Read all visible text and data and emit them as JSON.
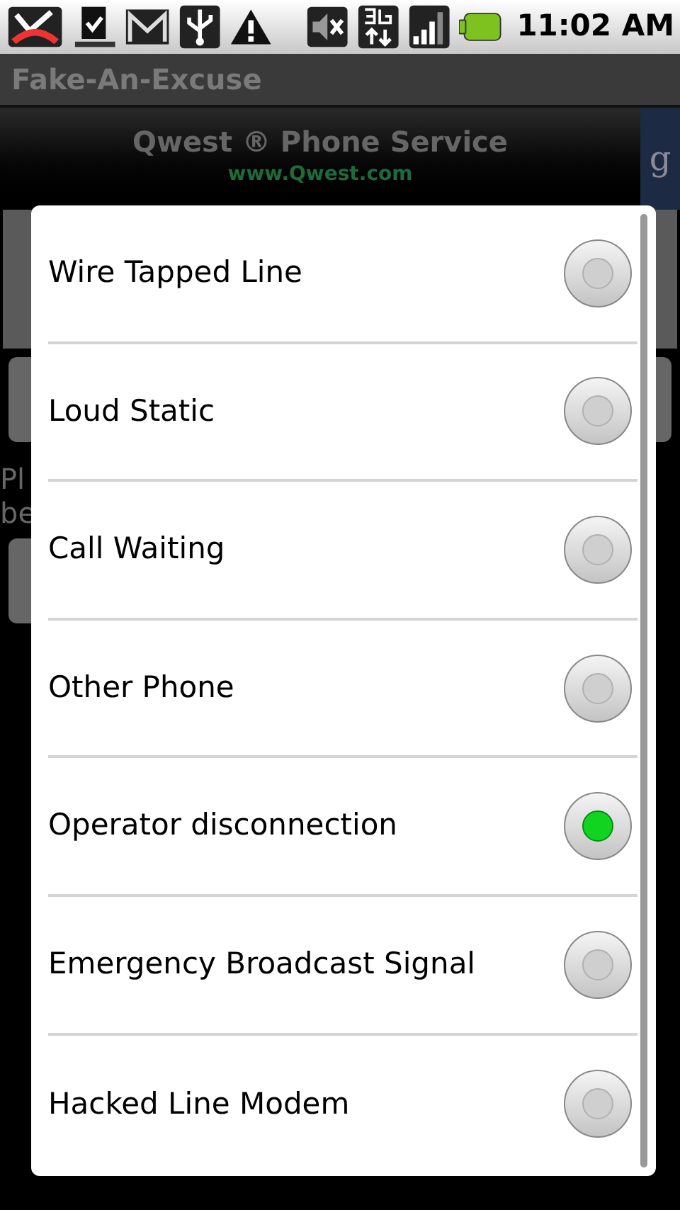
{
  "status_bar": {
    "time": "11:02 AM"
  },
  "app_title": "Fake-An-Excuse",
  "ad_banner": {
    "title": "Qwest ® Phone Service",
    "url": "www.Qwest.com",
    "side_letter": "g"
  },
  "background_text": [
    "Pl",
    "be"
  ],
  "options": [
    {
      "label": "Wire Tapped Line",
      "selected": false
    },
    {
      "label": "Loud Static",
      "selected": false
    },
    {
      "label": "Call Waiting",
      "selected": false
    },
    {
      "label": "Other Phone",
      "selected": false
    },
    {
      "label": "Operator disconnection",
      "selected": true
    },
    {
      "label": "Emergency Broadcast Signal",
      "selected": false
    },
    {
      "label": "Hacked Line Modem",
      "selected": false
    }
  ]
}
